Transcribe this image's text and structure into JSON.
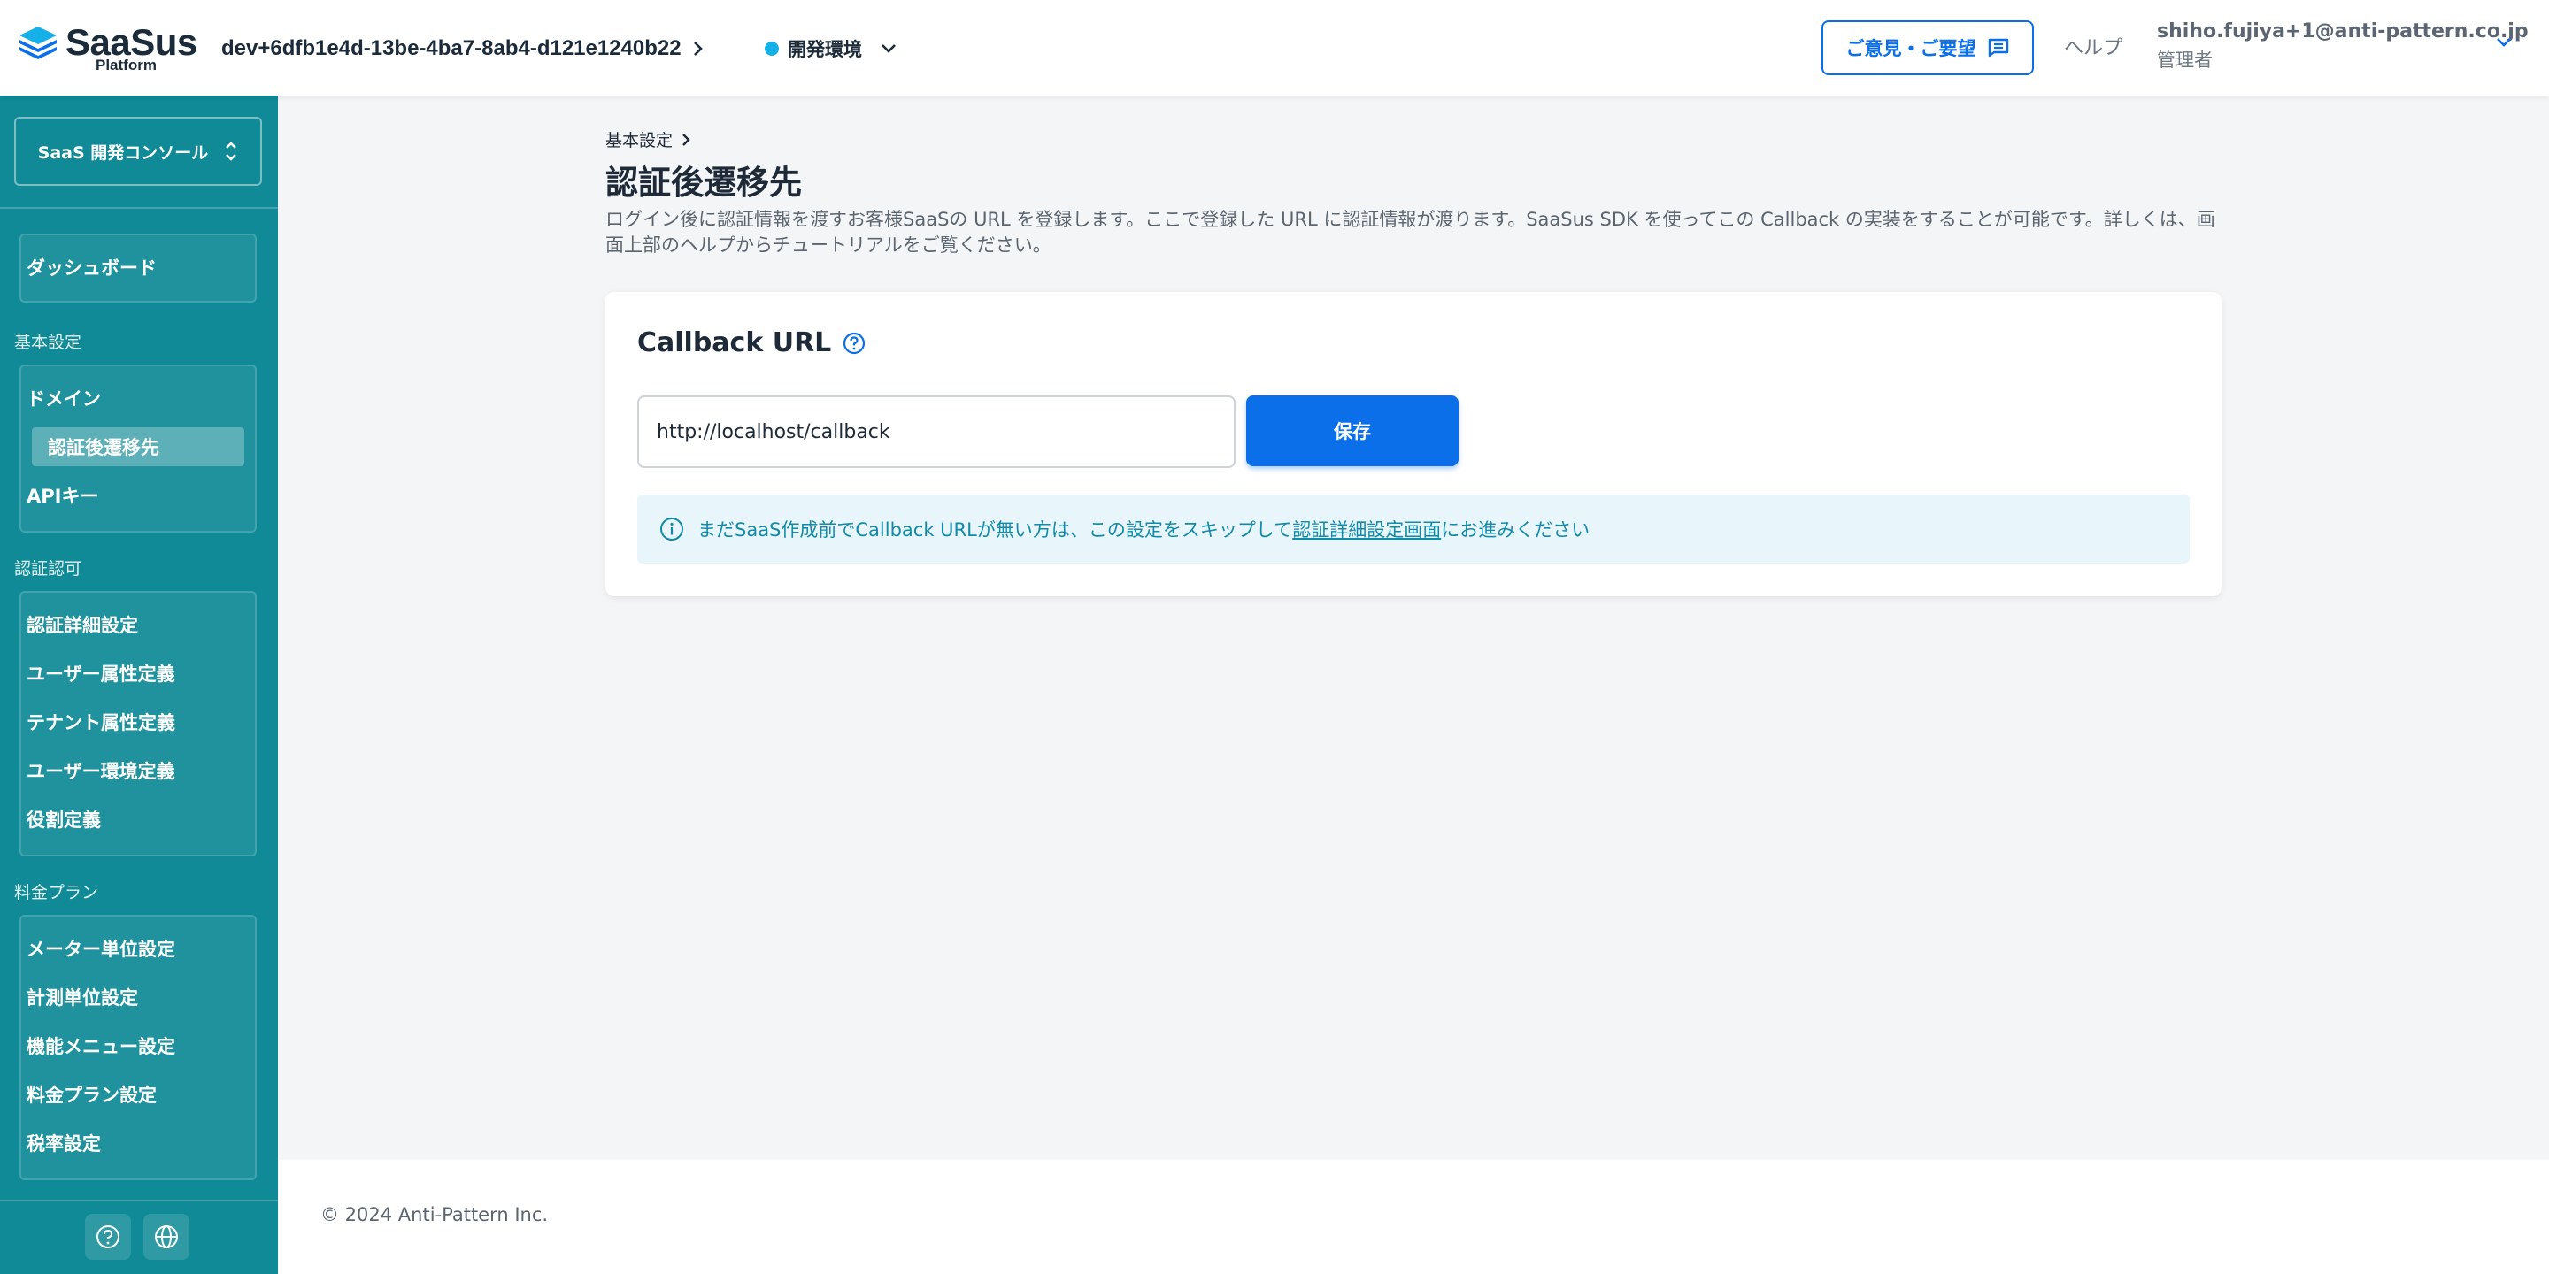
{
  "header": {
    "logo_text": "SaaSus",
    "logo_sub": "Platform",
    "env_id": "dev+6dfb1e4d-13be-4ba7-8ab4-d121e1240b22",
    "env_name": "開発環境",
    "feedback_label": "ご意見・ご要望",
    "help_label": "ヘルプ",
    "user_email": "shiho.fujiya+1@anti-pattern.co.jp",
    "user_role": "管理者"
  },
  "sidebar": {
    "console_label": "SaaS 開発コンソール",
    "dashboard": "ダッシュボード",
    "sections": [
      {
        "label": "基本設定",
        "items": [
          "ドメイン",
          "認証後遷移先",
          "APIキー"
        ]
      },
      {
        "label": "認証認可",
        "items": [
          "認証詳細設定",
          "ユーザー属性定義",
          "テナント属性定義",
          "ユーザー環境定義",
          "役割定義"
        ]
      },
      {
        "label": "料金プラン",
        "items": [
          "メーター単位設定",
          "計測単位設定",
          "機能メニュー設定",
          "料金プラン設定",
          "税率設定"
        ]
      }
    ]
  },
  "main": {
    "breadcrumb": "基本設定",
    "title": "認証後遷移先",
    "description": "ログイン後に認証情報を渡すお客様SaaSの URL を登録します。ここで登録した URL に認証情報が渡ります。SaaSus SDK を使ってこの Callback の実装をすることが可能です。詳しくは、画面上部のヘルプからチュートリアルをご覧ください。",
    "card_title": "Callback URL",
    "url_value": "http://localhost/callback",
    "save_label": "保存",
    "info_before": "まだSaaS作成前でCallback URLが無い方は、この設定をスキップして",
    "info_link": "認証詳細設定画面",
    "info_after": "にお進みください"
  },
  "footer": {
    "copyright": "© 2024 Anti-Pattern Inc."
  },
  "colors": {
    "accent": "#0a6fe8",
    "sidebar": "#0f8a96",
    "info_bg": "#e8f6fb",
    "env_dot": "#16b0e8"
  }
}
